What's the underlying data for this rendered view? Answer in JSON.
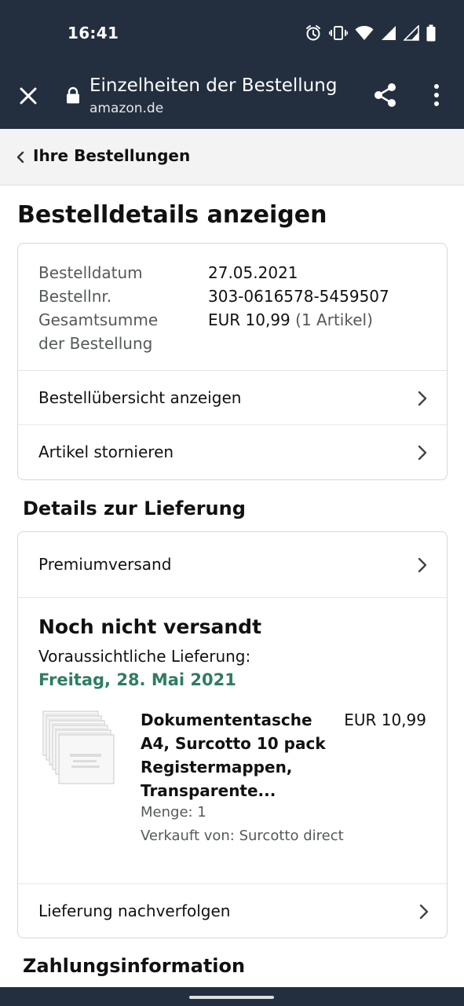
{
  "status_bar": {
    "time": "16:41",
    "icons": [
      "alarm-icon",
      "vibrate-icon",
      "wifi-icon",
      "signal-icon",
      "signal-icon",
      "battery-icon"
    ]
  },
  "custom_tab": {
    "title": "Einzelheiten der Bestellung",
    "url": "amazon.de",
    "icons": [
      "close-icon",
      "lock-icon",
      "share-icon",
      "more-vert-icon"
    ]
  },
  "breadcrumb": {
    "label": "Ihre Bestellungen"
  },
  "page_title": "Bestelldetails anzeigen",
  "order_summary": {
    "date_label": "Bestelldatum",
    "date_value": "27.05.2021",
    "number_label": "Bestellnr.",
    "number_value": "303-0616578-5459507",
    "total_label_line1": "Gesamtsumme",
    "total_label_line2": "der Bestellung",
    "total_value": "EUR 10,99",
    "total_items": "(1 Artikel)",
    "links": [
      "Bestellübersicht anzeigen",
      "Artikel stornieren"
    ]
  },
  "delivery": {
    "heading": "Details zur Lieferung",
    "method": "Premiumversand",
    "status": "Noch nicht versandt",
    "expected_label": "Voraussichtliche Lieferung:",
    "expected_date": "Freitag, 28. Mai 2021",
    "item": {
      "name_line1": "Dokumententasche",
      "name_line2": "A4, Surcotto 10 pack",
      "name_line3": "Registermappen,",
      "name_line4": "Transparente...",
      "price": "EUR 10,99",
      "quantity": "Menge: 1",
      "seller": "Verkauft von: Surcotto direct"
    },
    "track_link": "Lieferung nachverfolgen"
  },
  "payment": {
    "heading": "Zahlungsinformation"
  },
  "colors": {
    "header_bg": "#232f3e",
    "delivery_date": "#2e7d60",
    "muted_text": "#565959"
  }
}
